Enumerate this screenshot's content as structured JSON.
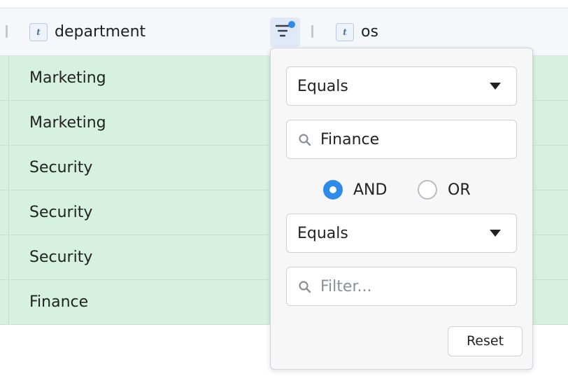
{
  "header": {
    "columns": [
      {
        "type_badge": "t",
        "label": "department"
      },
      {
        "type_badge": "t",
        "label": "os"
      }
    ],
    "filter_active_color": "#2f8be9"
  },
  "rows": [
    {
      "department": "Marketing"
    },
    {
      "department": "Marketing"
    },
    {
      "department": "Security"
    },
    {
      "department": "Security"
    },
    {
      "department": "Security"
    },
    {
      "department": "Finance"
    }
  ],
  "filter_popup": {
    "condition1": {
      "operator": "Equals",
      "value": "Finance"
    },
    "join_options": [
      "AND",
      "OR"
    ],
    "join_selected": "AND",
    "condition2": {
      "operator": "Equals",
      "placeholder": "Filter..."
    },
    "reset_label": "Reset"
  },
  "colors": {
    "row_background": "#d6f1e0",
    "accent": "#2f8be9"
  }
}
